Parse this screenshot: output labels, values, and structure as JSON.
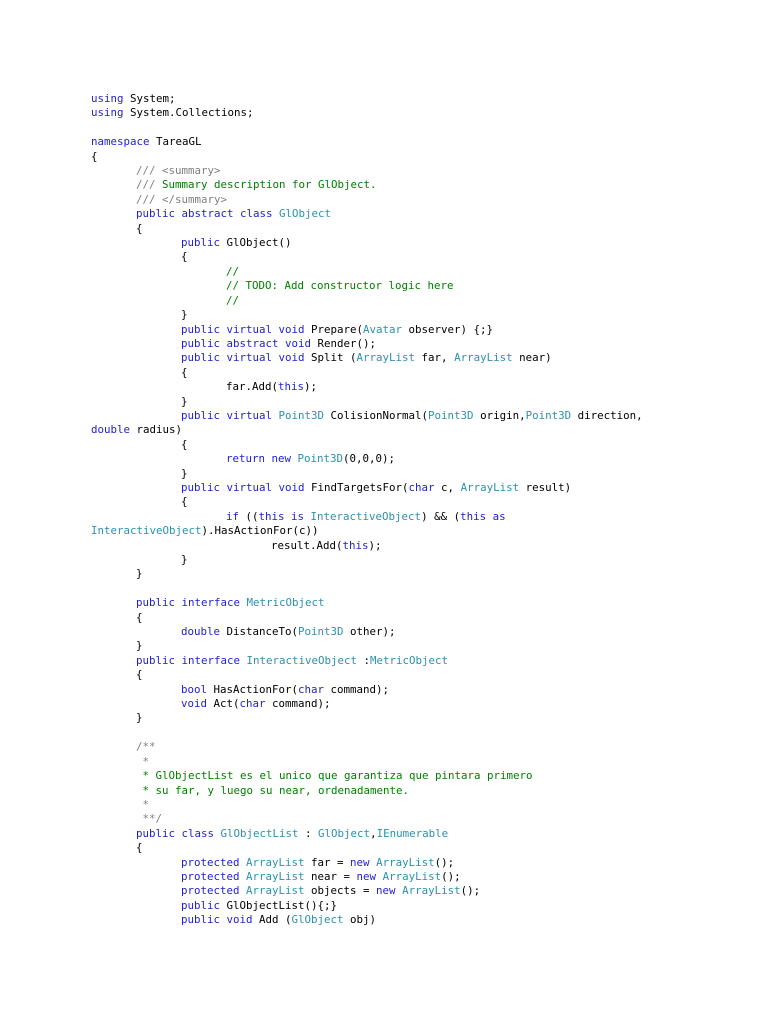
{
  "colors": {
    "keyword": "#1f1fd0",
    "type": "#2b91af",
    "comment": "#008000",
    "doc": "#808080",
    "text": "#000000"
  },
  "lines": [
    {
      "i": 0,
      "t": [
        [
          "k",
          "using"
        ],
        [
          "n",
          " System;"
        ]
      ]
    },
    {
      "i": 0,
      "t": [
        [
          "k",
          "using"
        ],
        [
          "n",
          " System.Collections;"
        ]
      ]
    },
    {
      "i": 0,
      "t": []
    },
    {
      "i": 0,
      "t": [
        [
          "k",
          "namespace"
        ],
        [
          "n",
          " TareaGL"
        ]
      ]
    },
    {
      "i": 0,
      "t": [
        [
          "n",
          "{"
        ]
      ]
    },
    {
      "i": 1,
      "t": [
        [
          "g",
          "/// <summary>"
        ]
      ]
    },
    {
      "i": 1,
      "t": [
        [
          "g",
          "/// "
        ],
        [
          "c",
          "Summary description for GlObject."
        ]
      ]
    },
    {
      "i": 1,
      "t": [
        [
          "g",
          "/// </summary>"
        ]
      ]
    },
    {
      "i": 1,
      "t": [
        [
          "k",
          "public abstract class "
        ],
        [
          "t",
          "GlObject"
        ]
      ]
    },
    {
      "i": 1,
      "t": [
        [
          "n",
          "{"
        ]
      ]
    },
    {
      "i": 2,
      "t": [
        [
          "k",
          "public "
        ],
        [
          "n",
          "GlObject()"
        ]
      ]
    },
    {
      "i": 2,
      "t": [
        [
          "n",
          "{"
        ]
      ]
    },
    {
      "i": 3,
      "t": [
        [
          "c",
          "//"
        ]
      ]
    },
    {
      "i": 3,
      "t": [
        [
          "c",
          "// TODO: Add constructor logic here"
        ]
      ]
    },
    {
      "i": 3,
      "t": [
        [
          "c",
          "//"
        ]
      ]
    },
    {
      "i": 2,
      "t": [
        [
          "n",
          "}"
        ]
      ]
    },
    {
      "i": 2,
      "t": [
        [
          "k",
          "public virtual void "
        ],
        [
          "n",
          "Prepare("
        ],
        [
          "t",
          "Avatar"
        ],
        [
          "n",
          " observer) {;}"
        ]
      ]
    },
    {
      "i": 2,
      "t": [
        [
          "k",
          "public abstract void "
        ],
        [
          "n",
          "Render();"
        ]
      ]
    },
    {
      "i": 2,
      "t": [
        [
          "k",
          "public virtual void "
        ],
        [
          "n",
          "Split ("
        ],
        [
          "t",
          "ArrayList"
        ],
        [
          "n",
          " far, "
        ],
        [
          "t",
          "ArrayList"
        ],
        [
          "n",
          " near)"
        ]
      ]
    },
    {
      "i": 2,
      "t": [
        [
          "n",
          "{"
        ]
      ]
    },
    {
      "i": 3,
      "t": [
        [
          "n",
          "far.Add("
        ],
        [
          "k",
          "this"
        ],
        [
          "n",
          ");"
        ]
      ]
    },
    {
      "i": 2,
      "t": [
        [
          "n",
          "}"
        ]
      ]
    },
    {
      "i": 2,
      "t": [
        [
          "k",
          "public virtual "
        ],
        [
          "t",
          "Point3D"
        ],
        [
          "n",
          " ColisionNormal("
        ],
        [
          "t",
          "Point3D"
        ],
        [
          "n",
          " origin,"
        ],
        [
          "t",
          "Point3D"
        ],
        [
          "n",
          " direction,"
        ]
      ]
    },
    {
      "i": 0,
      "t": [
        [
          "k",
          "double"
        ],
        [
          "n",
          " radius)"
        ]
      ]
    },
    {
      "i": 2,
      "t": [
        [
          "n",
          "{"
        ]
      ]
    },
    {
      "i": 3,
      "t": [
        [
          "k",
          "return new "
        ],
        [
          "t",
          "Point3D"
        ],
        [
          "n",
          "(0,0,0);"
        ]
      ]
    },
    {
      "i": 2,
      "t": [
        [
          "n",
          "}"
        ]
      ]
    },
    {
      "i": 2,
      "t": [
        [
          "k",
          "public virtual void "
        ],
        [
          "n",
          "FindTargetsFor("
        ],
        [
          "k",
          "char"
        ],
        [
          "n",
          " c, "
        ],
        [
          "t",
          "ArrayList"
        ],
        [
          "n",
          " result)"
        ]
      ]
    },
    {
      "i": 2,
      "t": [
        [
          "n",
          "{"
        ]
      ]
    },
    {
      "i": 3,
      "t": [
        [
          "k",
          "if"
        ],
        [
          "n",
          " (("
        ],
        [
          "k",
          "this is "
        ],
        [
          "t",
          "InteractiveObject"
        ],
        [
          "n",
          ") && ("
        ],
        [
          "k",
          "this as"
        ]
      ]
    },
    {
      "i": 0,
      "t": [
        [
          "t",
          "InteractiveObject"
        ],
        [
          "n",
          ").HasActionFor(c))"
        ]
      ]
    },
    {
      "i": 4,
      "t": [
        [
          "n",
          "result.Add("
        ],
        [
          "k",
          "this"
        ],
        [
          "n",
          ");"
        ]
      ]
    },
    {
      "i": 2,
      "t": [
        [
          "n",
          "}"
        ]
      ]
    },
    {
      "i": 1,
      "t": [
        [
          "n",
          "}"
        ]
      ]
    },
    {
      "i": 0,
      "t": []
    },
    {
      "i": 1,
      "t": [
        [
          "k",
          "public interface "
        ],
        [
          "t",
          "MetricObject"
        ]
      ]
    },
    {
      "i": 1,
      "t": [
        [
          "n",
          "{"
        ]
      ]
    },
    {
      "i": 2,
      "t": [
        [
          "k",
          "double "
        ],
        [
          "n",
          "DistanceTo("
        ],
        [
          "t",
          "Point3D"
        ],
        [
          "n",
          " other);"
        ]
      ]
    },
    {
      "i": 1,
      "t": [
        [
          "n",
          "}"
        ]
      ]
    },
    {
      "i": 1,
      "t": [
        [
          "k",
          "public interface "
        ],
        [
          "t",
          "InteractiveObject"
        ],
        [
          "n",
          " :"
        ],
        [
          "t",
          "MetricObject"
        ]
      ]
    },
    {
      "i": 1,
      "t": [
        [
          "n",
          "{"
        ]
      ]
    },
    {
      "i": 2,
      "t": [
        [
          "k",
          "bool "
        ],
        [
          "n",
          "HasActionFor("
        ],
        [
          "k",
          "char"
        ],
        [
          "n",
          " command);"
        ]
      ]
    },
    {
      "i": 2,
      "t": [
        [
          "k",
          "void "
        ],
        [
          "n",
          "Act("
        ],
        [
          "k",
          "char"
        ],
        [
          "n",
          " command);"
        ]
      ]
    },
    {
      "i": 1,
      "t": [
        [
          "n",
          "}"
        ]
      ]
    },
    {
      "i": 0,
      "t": []
    },
    {
      "i": 1,
      "t": [
        [
          "g",
          "/**"
        ]
      ]
    },
    {
      "i": 1,
      "t": [
        [
          "g",
          " *"
        ]
      ]
    },
    {
      "i": 1,
      "t": [
        [
          "c",
          " * GlObjectList es el unico que garantiza que pintara primero"
        ]
      ]
    },
    {
      "i": 1,
      "t": [
        [
          "c",
          " * su far, y luego su near, ordenadamente."
        ]
      ]
    },
    {
      "i": 1,
      "t": [
        [
          "g",
          " *"
        ]
      ]
    },
    {
      "i": 1,
      "t": [
        [
          "g",
          " **/"
        ]
      ]
    },
    {
      "i": 1,
      "t": [
        [
          "k",
          "public class "
        ],
        [
          "t",
          "GlObjectList"
        ],
        [
          "n",
          " : "
        ],
        [
          "t",
          "GlObject"
        ],
        [
          "n",
          ","
        ],
        [
          "t",
          "IEnumerable"
        ]
      ]
    },
    {
      "i": 1,
      "t": [
        [
          "n",
          "{"
        ]
      ]
    },
    {
      "i": 2,
      "t": [
        [
          "k",
          "protected "
        ],
        [
          "t",
          "ArrayList"
        ],
        [
          "n",
          " far = "
        ],
        [
          "k",
          "new "
        ],
        [
          "t",
          "ArrayList"
        ],
        [
          "n",
          "();"
        ]
      ]
    },
    {
      "i": 2,
      "t": [
        [
          "k",
          "protected "
        ],
        [
          "t",
          "ArrayList"
        ],
        [
          "n",
          " near = "
        ],
        [
          "k",
          "new "
        ],
        [
          "t",
          "ArrayList"
        ],
        [
          "n",
          "();"
        ]
      ]
    },
    {
      "i": 2,
      "t": [
        [
          "k",
          "protected "
        ],
        [
          "t",
          "ArrayList"
        ],
        [
          "n",
          " objects = "
        ],
        [
          "k",
          "new "
        ],
        [
          "t",
          "ArrayList"
        ],
        [
          "n",
          "();"
        ]
      ]
    },
    {
      "i": 2,
      "t": [
        [
          "k",
          "public "
        ],
        [
          "n",
          "GlObjectList(){;}"
        ]
      ]
    },
    {
      "i": 2,
      "t": [
        [
          "k",
          "public void "
        ],
        [
          "n",
          "Add ("
        ],
        [
          "t",
          "GlObject"
        ],
        [
          "n",
          " obj)"
        ]
      ]
    }
  ]
}
